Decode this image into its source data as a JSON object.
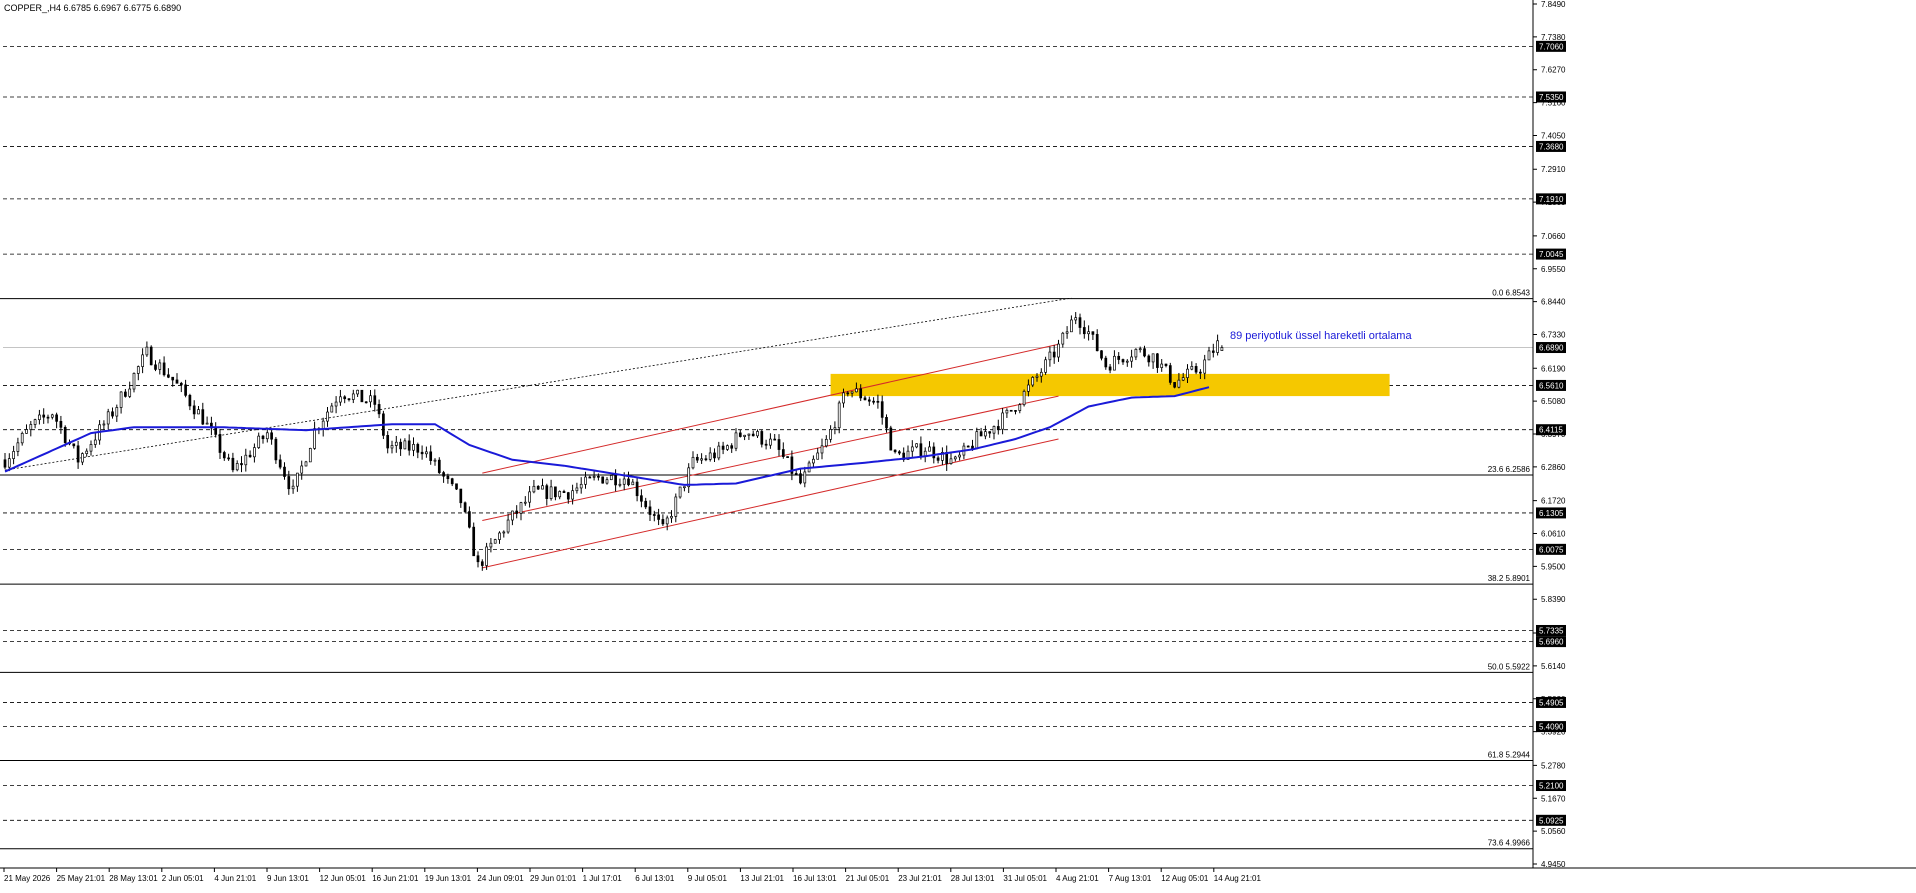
{
  "header": {
    "symbol_info": "COPPER_,H4  6.6785 6.6967 6.6775 6.6890"
  },
  "annotation": {
    "ema_label": "89 periyotluk üssel hareketli ortalama"
  },
  "colors": {
    "background": "#ffffff",
    "candle": "#000000",
    "ema": "#1a1ad8",
    "channel": "#d42a2a",
    "zone": "#f5c800",
    "ema_label": "#1a1ad8",
    "price_box": "#000000",
    "price_box_text": "#ffffff"
  },
  "chart_data": {
    "type": "candlestick",
    "symbol": "COPPER_",
    "timeframe": "H4",
    "ohlc_current": {
      "open": 6.6785,
      "high": 6.6967,
      "low": 6.6775,
      "close": 6.689
    },
    "ylim": [
      4.945,
      7.849
    ],
    "grid": false,
    "axis_ticks": [
      "7.8490",
      "7.7380",
      "7.6270",
      "7.5160",
      "7.4050",
      "7.2910",
      "7.1800",
      "7.0660",
      "6.9550",
      "6.8440",
      "6.7330",
      "6.6190",
      "6.5080",
      "6.3970",
      "6.2860",
      "6.1720",
      "6.0610",
      "5.9500",
      "5.8390",
      "5.7250",
      "5.6140",
      "5.5030",
      "5.3920",
      "5.2780",
      "5.1670",
      "5.0560",
      "4.9450"
    ],
    "x_tick_labels": [
      "21 May 2026",
      "25 May 21:01",
      "28 May 13:01",
      "2 Jun 05:01",
      "4 Jun 21:01",
      "9 Jun 13:01",
      "12 Jun 05:01",
      "16 Jun 21:01",
      "19 Jun 13:01",
      "24 Jun 09:01",
      "29 Jun 01:01",
      "1 Jul 17:01",
      "6 Jul 13:01",
      "9 Jul 05:01",
      "13 Jul 21:01",
      "16 Jul 13:01",
      "21 Jul 05:01",
      "23 Jul 21:01",
      "28 Jul 13:01",
      "31 Jul 05:01",
      "4 Aug 21:01",
      "7 Aug 13:01",
      "12 Aug 05:01",
      "14 Aug 21:01"
    ],
    "current_price": {
      "label": "6.6890",
      "value": 6.689
    },
    "horizontal_levels": [
      {
        "label": "7.7060",
        "value": 7.706
      },
      {
        "label": "7.5350",
        "value": 7.535
      },
      {
        "label": "7.3680",
        "value": 7.368
      },
      {
        "label": "7.1910",
        "value": 7.191
      },
      {
        "label": "7.0045",
        "value": 7.0045
      },
      {
        "label": "6.5610",
        "value": 6.561
      },
      {
        "label": "6.4115",
        "value": 6.4115
      },
      {
        "label": "6.1305",
        "value": 6.1305
      },
      {
        "label": "6.0075",
        "value": 6.0075
      },
      {
        "label": "5.7335",
        "value": 5.7335
      },
      {
        "label": "5.6960",
        "value": 5.696
      },
      {
        "label": "5.4905",
        "value": 5.4905
      },
      {
        "label": "5.4090",
        "value": 5.409
      },
      {
        "label": "5.2100",
        "value": 5.21
      },
      {
        "label": "5.0925",
        "value": 5.0925
      }
    ],
    "fibonacci_levels": [
      {
        "label": "0.0 6.8543",
        "value": 6.8543
      },
      {
        "label": "23.6 6.2586",
        "value": 6.2586
      },
      {
        "label": "38.2 5.8901",
        "value": 5.8901
      },
      {
        "label": "50.0 5.5922",
        "value": 5.5922
      },
      {
        "label": "61.8 5.2944",
        "value": 5.2944
      },
      {
        "label": "73.6 4.9966",
        "value": 4.9966
      }
    ],
    "zone": {
      "from_value": 6.525,
      "to_value": 6.6,
      "start_index": 192,
      "end_index": 322
    },
    "channel_lines": [
      {
        "name": "upper",
        "points": [
          [
            111,
            6.265
          ],
          [
            245,
            6.7
          ]
        ]
      },
      {
        "name": "middle",
        "points": [
          [
            111,
            6.105
          ],
          [
            245,
            6.525
          ]
        ]
      },
      {
        "name": "lower",
        "points": [
          [
            111,
            5.945
          ],
          [
            245,
            6.38
          ]
        ]
      }
    ],
    "trend_line": {
      "points": [
        [
          0,
          6.275
        ],
        [
          248,
          6.856
        ]
      ]
    },
    "ema_key": [
      [
        0,
        6.27
      ],
      [
        20,
        6.4
      ],
      [
        30,
        6.42
      ],
      [
        50,
        6.42
      ],
      [
        70,
        6.41
      ],
      [
        90,
        6.43
      ],
      [
        100,
        6.43
      ],
      [
        108,
        6.36
      ],
      [
        118,
        6.31
      ],
      [
        130,
        6.29
      ],
      [
        145,
        6.255
      ],
      [
        158,
        6.225
      ],
      [
        170,
        6.23
      ],
      [
        185,
        6.28
      ],
      [
        200,
        6.3
      ],
      [
        213,
        6.32
      ],
      [
        225,
        6.345
      ],
      [
        235,
        6.38
      ],
      [
        243,
        6.42
      ],
      [
        252,
        6.49
      ],
      [
        262,
        6.52
      ],
      [
        272,
        6.525
      ],
      [
        280,
        6.555
      ]
    ],
    "price_path": [
      [
        0,
        6.31
      ],
      [
        6,
        6.42
      ],
      [
        11,
        6.47
      ],
      [
        17,
        6.31
      ],
      [
        25,
        6.47
      ],
      [
        33,
        6.67
      ],
      [
        39,
        6.58
      ],
      [
        46,
        6.45
      ],
      [
        53,
        6.27
      ],
      [
        61,
        6.4
      ],
      [
        67,
        6.2
      ],
      [
        72,
        6.41
      ],
      [
        78,
        6.54
      ],
      [
        86,
        6.5
      ],
      [
        89,
        6.35
      ],
      [
        97,
        6.35
      ],
      [
        106,
        6.17
      ],
      [
        110,
        5.95
      ],
      [
        117,
        6.1
      ],
      [
        123,
        6.2
      ],
      [
        131,
        6.2
      ],
      [
        138,
        6.25
      ],
      [
        145,
        6.25
      ],
      [
        153,
        6.07
      ],
      [
        160,
        6.3
      ],
      [
        167,
        6.34
      ],
      [
        172,
        6.41
      ],
      [
        179,
        6.36
      ],
      [
        185,
        6.23
      ],
      [
        191,
        6.37
      ],
      [
        196,
        6.55
      ],
      [
        203,
        6.5
      ],
      [
        207,
        6.32
      ],
      [
        214,
        6.35
      ],
      [
        221,
        6.3
      ],
      [
        226,
        6.38
      ],
      [
        233,
        6.46
      ],
      [
        239,
        6.57
      ],
      [
        245,
        6.69
      ],
      [
        249,
        6.8
      ],
      [
        252,
        6.74
      ],
      [
        256,
        6.63
      ],
      [
        263,
        6.68
      ],
      [
        267,
        6.66
      ],
      [
        272,
        6.57
      ],
      [
        278,
        6.62
      ],
      [
        282,
        6.7
      ],
      [
        283,
        6.689
      ]
    ]
  }
}
